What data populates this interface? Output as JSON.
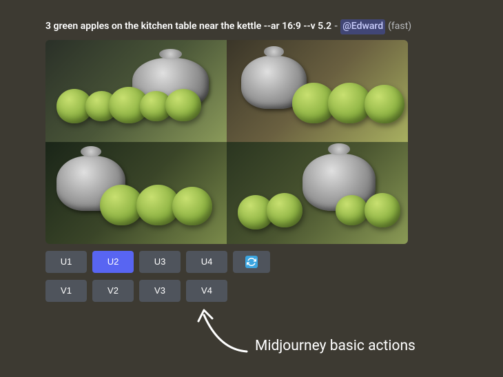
{
  "prompt": {
    "text": "3 green apples on the kitchen table near the kettle --ar 16:9 --v 5.2",
    "separator": "-",
    "mention": "@Edward",
    "mode": "(fast)"
  },
  "buttons": {
    "upscale": [
      {
        "label": "U1",
        "active": false
      },
      {
        "label": "U2",
        "active": true
      },
      {
        "label": "U3",
        "active": false
      },
      {
        "label": "U4",
        "active": false
      }
    ],
    "variation": [
      {
        "label": "V1",
        "active": false
      },
      {
        "label": "V2",
        "active": false
      },
      {
        "label": "V3",
        "active": false
      },
      {
        "label": "V4",
        "active": false
      }
    ],
    "reroll": {
      "icon": "reroll-icon"
    }
  },
  "annotation": {
    "text": "Midjourney basic actions"
  }
}
